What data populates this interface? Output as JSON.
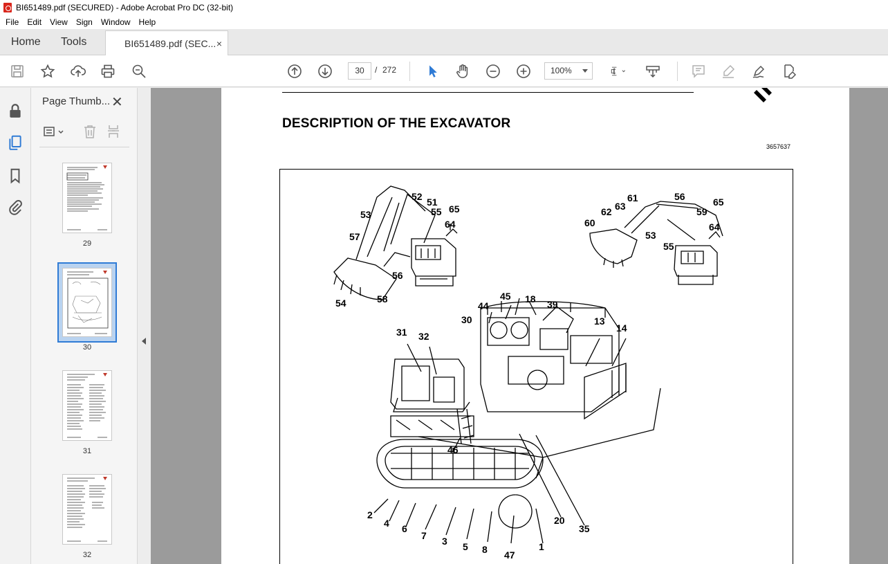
{
  "window": {
    "title": "BI651489.pdf (SECURED) - Adobe Acrobat Pro DC (32-bit)"
  },
  "menu": [
    "File",
    "Edit",
    "View",
    "Sign",
    "Window",
    "Help"
  ],
  "tabs": {
    "home": "Home",
    "tools": "Tools",
    "document": "BI651489.pdf (SEC...",
    "close": "×"
  },
  "toolbar": {
    "current_page": "30",
    "page_separator": "/",
    "total_pages": "272",
    "zoom": "100%"
  },
  "thumbnails_panel": {
    "title": "Page Thumb...",
    "close": "✕",
    "pages": [
      {
        "label": "29"
      },
      {
        "label": "30",
        "selected": true
      },
      {
        "label": "31"
      },
      {
        "label": "32"
      }
    ]
  },
  "document": {
    "heading": "DESCRIPTION OF THE EXCAVATOR",
    "figure_ref": "3657637",
    "callouts": [
      "52",
      "51",
      "55",
      "65",
      "53",
      "64",
      "57",
      "56",
      "54",
      "58",
      "61",
      "56",
      "62",
      "63",
      "59",
      "65",
      "60",
      "64",
      "53",
      "55",
      "45",
      "18",
      "44",
      "39",
      "30",
      "13",
      "14",
      "31",
      "32",
      "46",
      "2",
      "4",
      "6",
      "7",
      "3",
      "5",
      "8",
      "47",
      "1",
      "20",
      "35"
    ]
  },
  "colors": {
    "accent": "#2f7bd5",
    "app_red": "#d9261c",
    "doc_background": "#9b9b9b"
  }
}
